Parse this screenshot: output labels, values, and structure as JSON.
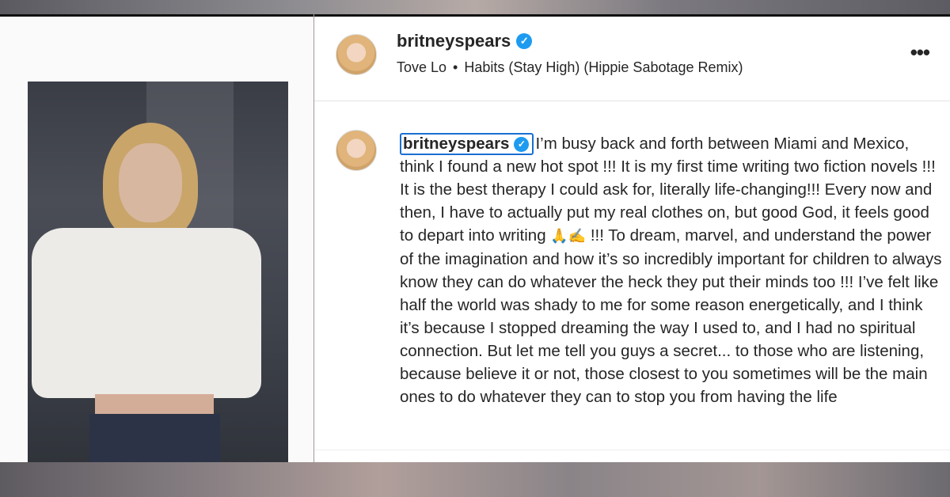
{
  "post": {
    "username": "britneyspears",
    "verified_symbol": "✓",
    "audio": {
      "artist": "Tove Lo",
      "separator": "•",
      "track": "Habits (Stay High) (Hippie Sabotage Remix)"
    },
    "more_options": "•••"
  },
  "caption": {
    "username": "britneyspears",
    "text_part1": "I’m busy back and forth between Miami and Mexico, think I found a new hot spot !!! It is my first time writing two fiction novels !!! It is the best therapy I could ask for, literally life-changing!!! Every now and then, I have to actually put my real clothes on, but good God, it feels good to depart into writing ",
    "emoji": "🙏✍️",
    "text_part2": " !!! To dream, marvel, and understand the power of the imagination and how it’s so incredibly important for children to always know they can do whatever the heck they put their minds too !!! I’ve felt like half the world was shady to me for some reason energetically, and I think it’s because I stopped dreaming the way I used to, and I had no spiritual connection. But let me tell you guys a secret... to those who are listening, because believe it or not, those closest to you sometimes will be the main ones to do whatever they can to stop you from having the life"
  },
  "icons": {
    "verified": "verified-check-icon",
    "more": "more-options-icon"
  },
  "colors": {
    "verified_blue": "#1d9bf0",
    "highlight_box": "#1a6fd1",
    "text": "#262626"
  }
}
